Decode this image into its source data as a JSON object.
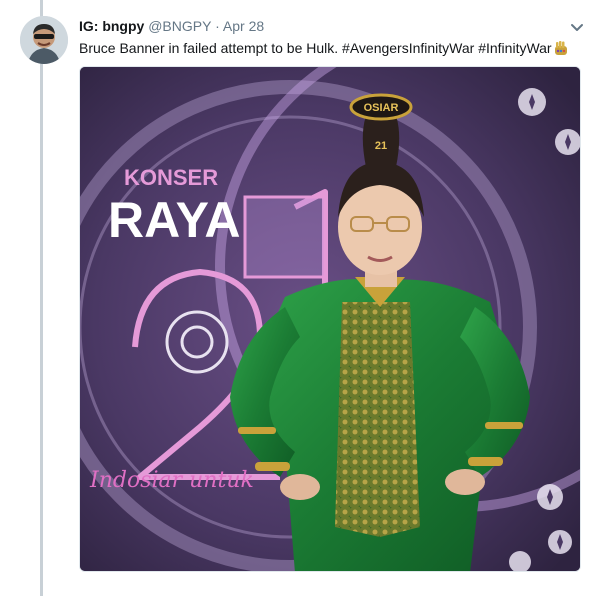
{
  "tweet": {
    "display_name": "IG: bngpy",
    "handle": "@BNGPY",
    "separator": "·",
    "date": "Apr 28",
    "text": "Bruce Banner in failed attempt to be Hulk. #AvengersInfinityWar #InfinityWar",
    "emoji": "infinity-gauntlet-emoji",
    "caret_icon": "chevron-down-icon"
  },
  "media": {
    "backdrop": {
      "logo_top": "KONSER",
      "logo_main": "RAYA",
      "tagline": "Indosiar untuk",
      "crown_text": "OSIAR",
      "crown_number": "21"
    }
  },
  "colors": {
    "name": "#14171a",
    "secondary": "#657786",
    "thread_line": "#c8d0d6",
    "backdrop_purple": "#3d2d55",
    "logo_pink": "#e59ad8",
    "suit_green": "#1f8a3a"
  }
}
